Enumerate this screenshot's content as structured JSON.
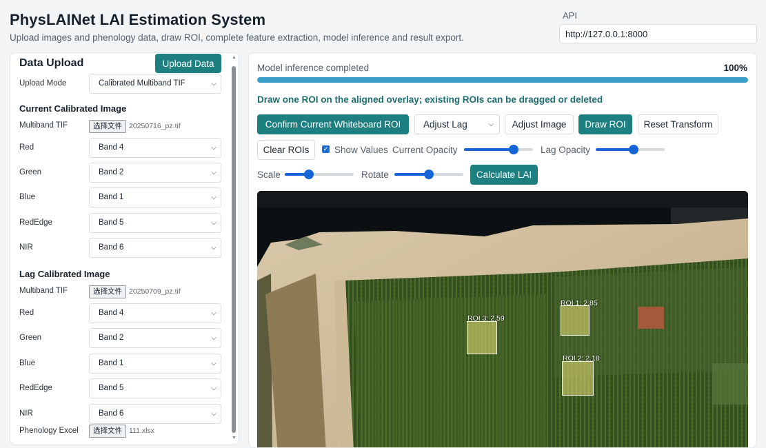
{
  "header": {
    "title": "PhysLAINet LAI Estimation System",
    "subtitle": "Upload images and phenology data, draw ROI, complete feature extraction, model inference and result export.",
    "api_label": "API",
    "api_value": "http://127.0.0.1:8000"
  },
  "upload": {
    "title": "Data Upload",
    "upload_button": "Upload Data",
    "mode_label": "Upload Mode",
    "mode_value": "Calibrated Multiband TIF",
    "current": {
      "title": "Current Calibrated Image",
      "tif_label": "Multiband TIF",
      "file_button": "选择文件",
      "file_name": "20250716_pz.tif",
      "bands": [
        {
          "label": "Red",
          "value": "Band 4"
        },
        {
          "label": "Green",
          "value": "Band 2"
        },
        {
          "label": "Blue",
          "value": "Band 1"
        },
        {
          "label": "RedEdge",
          "value": "Band 5"
        },
        {
          "label": "NIR",
          "value": "Band 6"
        }
      ]
    },
    "lag": {
      "title": "Lag Calibrated Image",
      "tif_label": "Multiband TIF",
      "file_button": "选择文件",
      "file_name": "20250709_pz.tif",
      "bands": [
        {
          "label": "Red",
          "value": "Band 4"
        },
        {
          "label": "Green",
          "value": "Band 2"
        },
        {
          "label": "Blue",
          "value": "Band 1"
        },
        {
          "label": "RedEdge",
          "value": "Band 5"
        },
        {
          "label": "NIR",
          "value": "Band 6"
        }
      ]
    },
    "phenology": {
      "label": "Phenology Excel",
      "file_button": "选择文件",
      "file_name": "111.xlsx"
    }
  },
  "workspace": {
    "status_text": "Model inference completed",
    "progress_label": "100%",
    "progress_fraction": 1.0,
    "hint": "Draw one ROI on the aligned overlay; existing ROIs can be dragged or deleted",
    "buttons": {
      "confirm_roi": "Confirm Current Whiteboard ROI",
      "adjust_lag": "Adjust Lag",
      "adjust_image": "Adjust Image",
      "draw_roi": "Draw ROI",
      "reset_transform": "Reset Transform",
      "clear_rois": "Clear ROIs",
      "calculate_lai": "Calculate LAI"
    },
    "show_values_label": "Show Values",
    "show_values_checked": true,
    "current_opacity_label": "Current Opacity",
    "current_opacity_value": 0.72,
    "lag_opacity_label": "Lag Opacity",
    "lag_opacity_value": 0.55,
    "scale_label": "Scale",
    "scale_value": 0.35,
    "rotate_label": "Rotate",
    "rotate_value": 0.5,
    "rois": [
      {
        "label": "ROI 1: 2.85"
      },
      {
        "label": "ROI 2: 2.18"
      },
      {
        "label": "ROI 3: 2.59"
      }
    ]
  },
  "colors": {
    "primary": "#1d7f80",
    "progress": "#3a9ec9",
    "slider": "#1565d8",
    "hint_text": "#1d6e70"
  }
}
